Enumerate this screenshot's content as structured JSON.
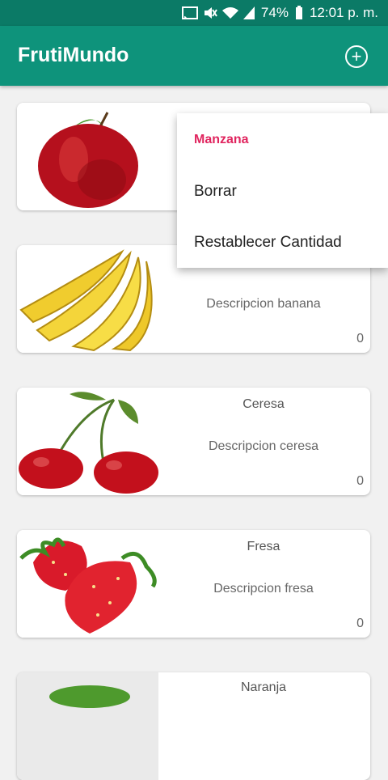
{
  "status": {
    "battery": "74%",
    "time": "12:01 p. m."
  },
  "app": {
    "title": "FrutiMundo",
    "add_icon": "plus-circle-icon"
  },
  "fruits": [
    {
      "name": "",
      "description": "",
      "count": ""
    },
    {
      "name": "",
      "description": "Descripcion banana",
      "count": "0"
    },
    {
      "name": "Ceresa",
      "description": "Descripcion ceresa",
      "count": "0"
    },
    {
      "name": "Fresa",
      "description": "Descripcion fresa",
      "count": "0"
    },
    {
      "name": "Naranja",
      "description": "",
      "count": ""
    }
  ],
  "context_menu": {
    "title": "Manzana",
    "items": [
      "Borrar",
      "Restablecer Cantidad"
    ]
  },
  "colors": {
    "app_bar": "#0e937b",
    "status_bar": "#0b7a66",
    "menu_title": "#e0245e"
  }
}
